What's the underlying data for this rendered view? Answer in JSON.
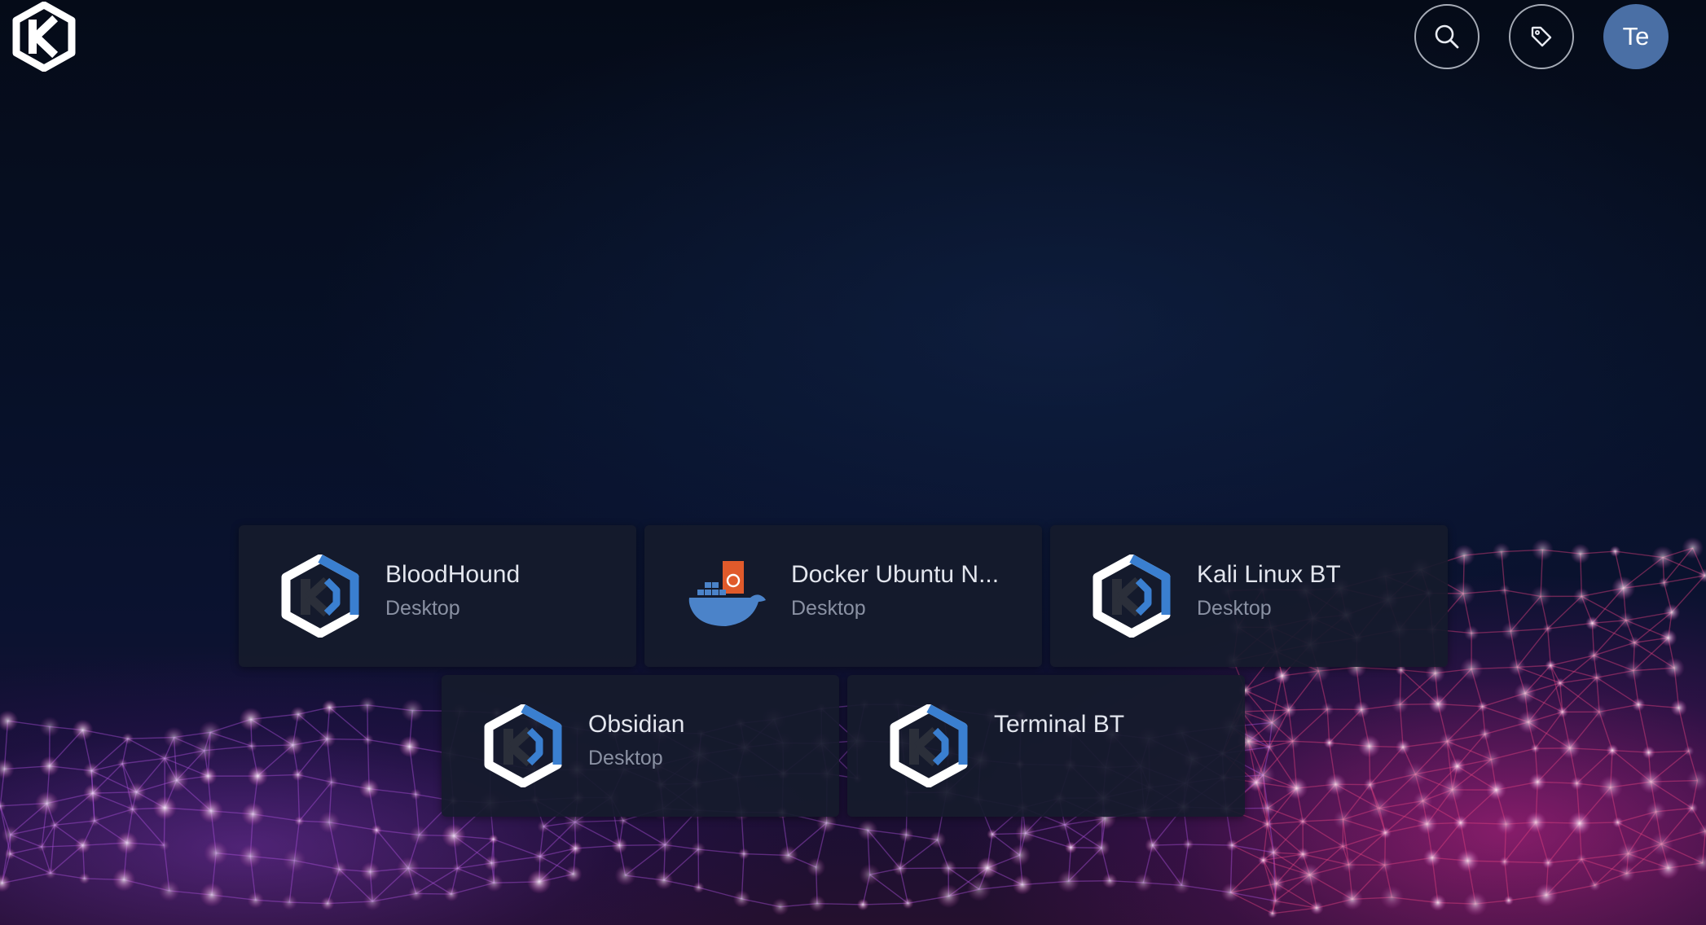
{
  "header": {
    "logo": "kasm-logo-icon",
    "search_icon": "search-icon",
    "tag_icon": "tag-icon",
    "avatar_initials": "Te",
    "avatar_color": "#4a6fa5"
  },
  "workspaces": [
    {
      "title": "BloodHound",
      "subtitle": "Desktop",
      "icon": "kasm-hex-icon"
    },
    {
      "title": "Docker Ubuntu N...",
      "subtitle": "Desktop",
      "icon": "docker-ubuntu-icon"
    },
    {
      "title": "Kali Linux BT",
      "subtitle": "Desktop",
      "icon": "kasm-hex-icon"
    },
    {
      "title": "Obsidian",
      "subtitle": "Desktop",
      "icon": "kasm-hex-icon"
    },
    {
      "title": "Terminal BT",
      "subtitle": "",
      "icon": "kasm-hex-icon"
    }
  ],
  "colors": {
    "card_bg": "#161b2c",
    "title_text": "#e3e6ee",
    "subtitle_text": "#8a91a3",
    "kasm_blue": "#3a7fd0",
    "docker_blue": "#4b83c9",
    "ubuntu_orange": "#e05a2b"
  }
}
